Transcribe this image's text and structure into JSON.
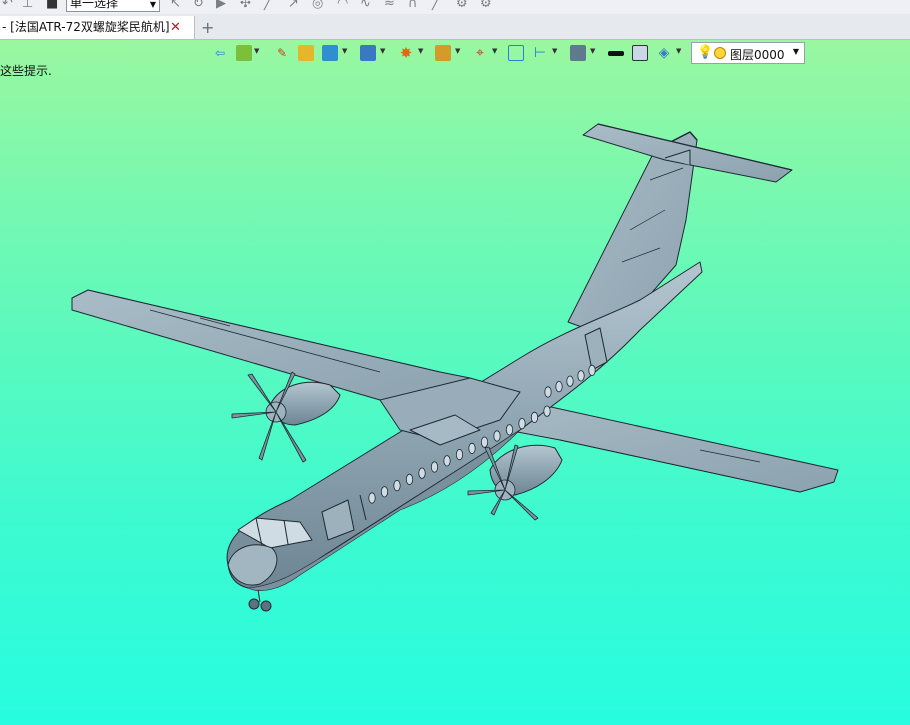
{
  "toolbar": {
    "selection_mode": "单一选择",
    "icons": [
      "undo-icon",
      "pin-icon",
      "stop-icon",
      "select-icon",
      "rotate-icon",
      "play-icon",
      "point-icon",
      "line-icon",
      "arrow-icon",
      "circle-icon",
      "arc-icon",
      "spline-icon",
      "curve-icon",
      "sketch-icon",
      "settings-icon"
    ]
  },
  "tabs": {
    "active_title": "- [法国ATR-72双螺旋桨民航机]",
    "close_glyph": "✕",
    "new_glyph": "+"
  },
  "viewport": {
    "hint_text": "这些提示.",
    "background_colors": [
      "#9af7a0",
      "#27fce0"
    ],
    "layer_selector": {
      "value": "图层0000"
    }
  },
  "view_toolbar_icons": [
    "exit-icon",
    "material-icon",
    "brush-icon",
    "shaded-box-icon",
    "view-cube-icon",
    "display-mode-icon",
    "render-style-icon",
    "section-icon",
    "snap-icon",
    "frame-icon",
    "dimension-icon",
    "screen-icon",
    "line-color-icon",
    "fill-color-icon",
    "layer-stack-icon"
  ],
  "model": {
    "color": "#8fa5b2",
    "name": "ATR-72"
  }
}
